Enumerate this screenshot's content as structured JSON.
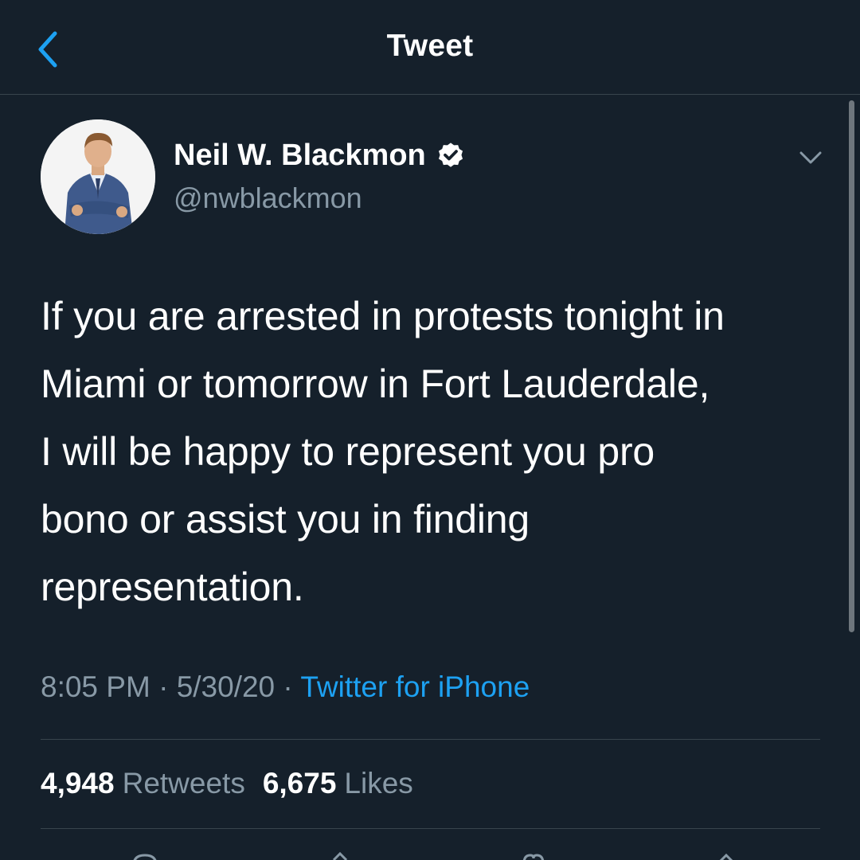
{
  "header": {
    "title": "Tweet",
    "back_icon": "chevron-left-icon",
    "accent_color": "#1da1f2"
  },
  "author": {
    "display_name": "Neil W. Blackmon",
    "handle": "@nwblackmon",
    "verified_icon": "verified-badge-icon"
  },
  "tweet": {
    "lines": [
      "If you are arrested in protests tonight in",
      "Miami or tomorrow in Fort Lauderdale,",
      "I will be happy to represent you pro",
      "bono or assist you in finding",
      "representation."
    ]
  },
  "meta": {
    "time": "8:05 PM",
    "separator": " · ",
    "date": "5/30/20",
    "source": "Twitter for iPhone"
  },
  "stats": {
    "retweets_count": "4,948",
    "retweets_label": "Retweets",
    "likes_count": "6,675",
    "likes_label": "Likes"
  },
  "colors": {
    "background": "#15202b",
    "divider": "#38444d",
    "secondary_text": "#8899a6",
    "link": "#1da1f2"
  }
}
